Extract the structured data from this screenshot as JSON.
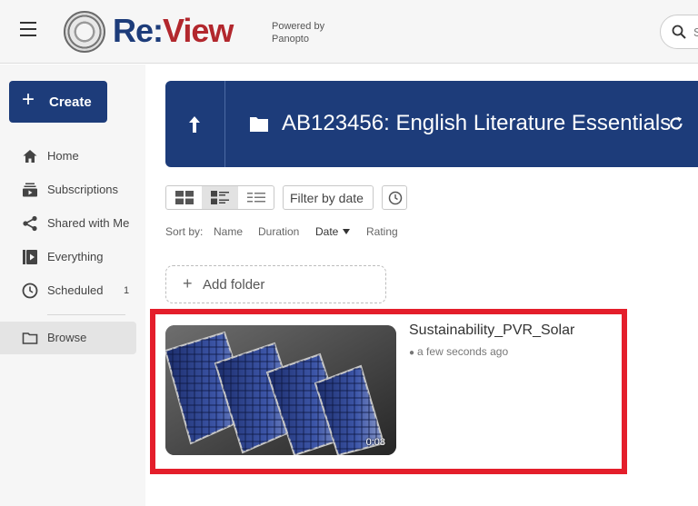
{
  "app": {
    "logo_re": "Re:",
    "logo_view": "View",
    "powered_line1": "Powered by",
    "powered_line2": "Panopto",
    "search_placeholder": "S"
  },
  "sidebar": {
    "create_label": "Create",
    "items": [
      {
        "label": "Home",
        "icon": "home-icon"
      },
      {
        "label": "Subscriptions",
        "icon": "subscriptions-icon"
      },
      {
        "label": "Shared with Me",
        "icon": "share-icon"
      },
      {
        "label": "Everything",
        "icon": "everything-icon"
      },
      {
        "label": "Scheduled",
        "icon": "clock-icon",
        "count": "1"
      },
      {
        "label": "Browse",
        "icon": "folder-icon"
      }
    ]
  },
  "folder": {
    "title": "AB123456: English Literature Essentials"
  },
  "toolbar": {
    "filter_label": "Filter by date"
  },
  "sort": {
    "label": "Sort by:",
    "options": [
      "Name",
      "Duration",
      "Date",
      "Rating"
    ],
    "active": "Date"
  },
  "add_folder_label": "Add folder",
  "session": {
    "title": "Sustainability_PVR_Solar",
    "time": "a few seconds ago",
    "duration": "0:08"
  },
  "colors": {
    "brand_blue": "#1d3c7a",
    "brand_red": "#b2272d",
    "highlight_red": "#e41e2b"
  }
}
